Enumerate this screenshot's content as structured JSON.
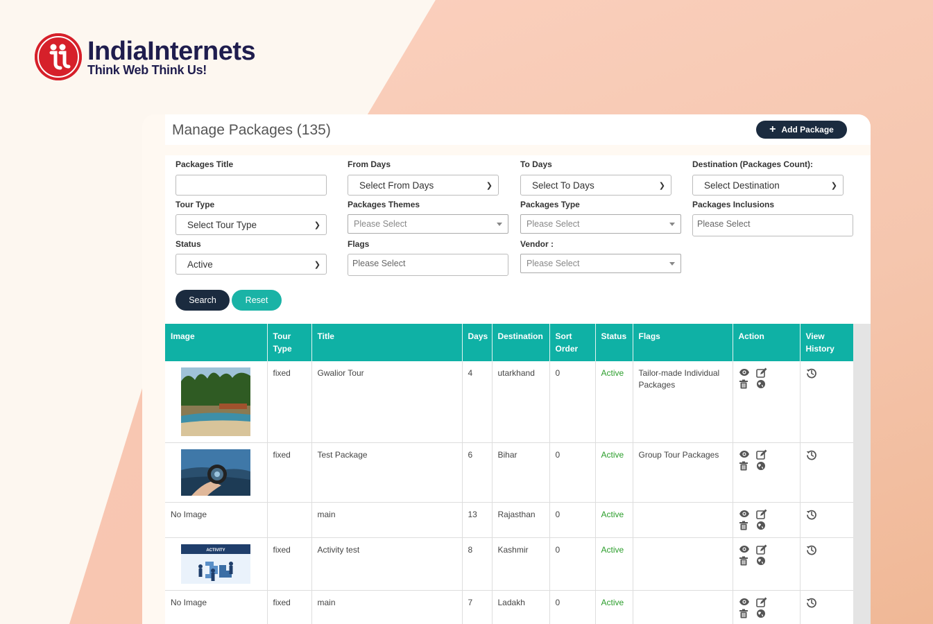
{
  "brand": {
    "name": "IndiaInternets",
    "tagline": "Think Web Think Us!"
  },
  "header": {
    "title": "Manage Packages (135)",
    "add_label": "Add Package"
  },
  "filters": {
    "packages_title": {
      "label": "Packages Title",
      "value": ""
    },
    "from_days": {
      "label": "From Days",
      "value": "Select From Days"
    },
    "to_days": {
      "label": "To Days",
      "value": "Select To Days"
    },
    "destination": {
      "label": "Destination (Packages Count):",
      "value": "Select Destination"
    },
    "tour_type": {
      "label": "Tour Type",
      "value": "Select Tour Type"
    },
    "themes": {
      "label": "Packages Themes",
      "placeholder": "Please Select"
    },
    "pkg_type": {
      "label": "Packages Type",
      "placeholder": "Please Select"
    },
    "inclusions": {
      "label": "Packages Inclusions",
      "placeholder": "Please Select"
    },
    "status": {
      "label": "Status",
      "value": "Active"
    },
    "flags": {
      "label": "Flags",
      "placeholder": "Please Select"
    },
    "vendor": {
      "label": "Vendor :",
      "placeholder": "Please Select"
    },
    "search_label": "Search",
    "reset_label": "Reset"
  },
  "table": {
    "columns": [
      "Image",
      "Tour Type",
      "Title",
      "Days",
      "Destination",
      "Sort Order",
      "Status",
      "Flags",
      "Action",
      "View History"
    ],
    "rows": [
      {
        "image": "beach",
        "image_text": "",
        "tour_type": "fixed",
        "title": "Gwalior Tour",
        "days": "4",
        "destination": "utarkhand",
        "sort": "0",
        "status": "Active",
        "flags": "Tailor-made Individual Packages"
      },
      {
        "image": "lens",
        "image_text": "",
        "tour_type": "fixed",
        "title": "Test Package",
        "days": "6",
        "destination": "Bihar",
        "sort": "0",
        "status": "Active",
        "flags": "Group Tour Packages"
      },
      {
        "image": "",
        "image_text": "No Image",
        "tour_type": "",
        "title": "main",
        "days": "13",
        "destination": "Rajasthan",
        "sort": "0",
        "status": "Active",
        "flags": ""
      },
      {
        "image": "activity",
        "image_text": "",
        "image_caption": "ACTIVITY",
        "tour_type": "fixed",
        "title": "Activity test",
        "days": "8",
        "destination": "Kashmir",
        "sort": "0",
        "status": "Active",
        "flags": ""
      },
      {
        "image": "",
        "image_text": "No Image",
        "tour_type": "fixed",
        "title": "main",
        "days": "7",
        "destination": "Ladakh",
        "sort": "0",
        "status": "Active",
        "flags": ""
      }
    ]
  },
  "icons": {
    "view": "eye-icon",
    "edit": "edit-icon",
    "delete": "trash-icon",
    "web": "globe-icon",
    "history": "history-icon"
  },
  "colors": {
    "accent": "#0fb1a5",
    "navy": "#1b2b3f",
    "active": "#2a9d2a",
    "brand_red": "#d6202a"
  }
}
